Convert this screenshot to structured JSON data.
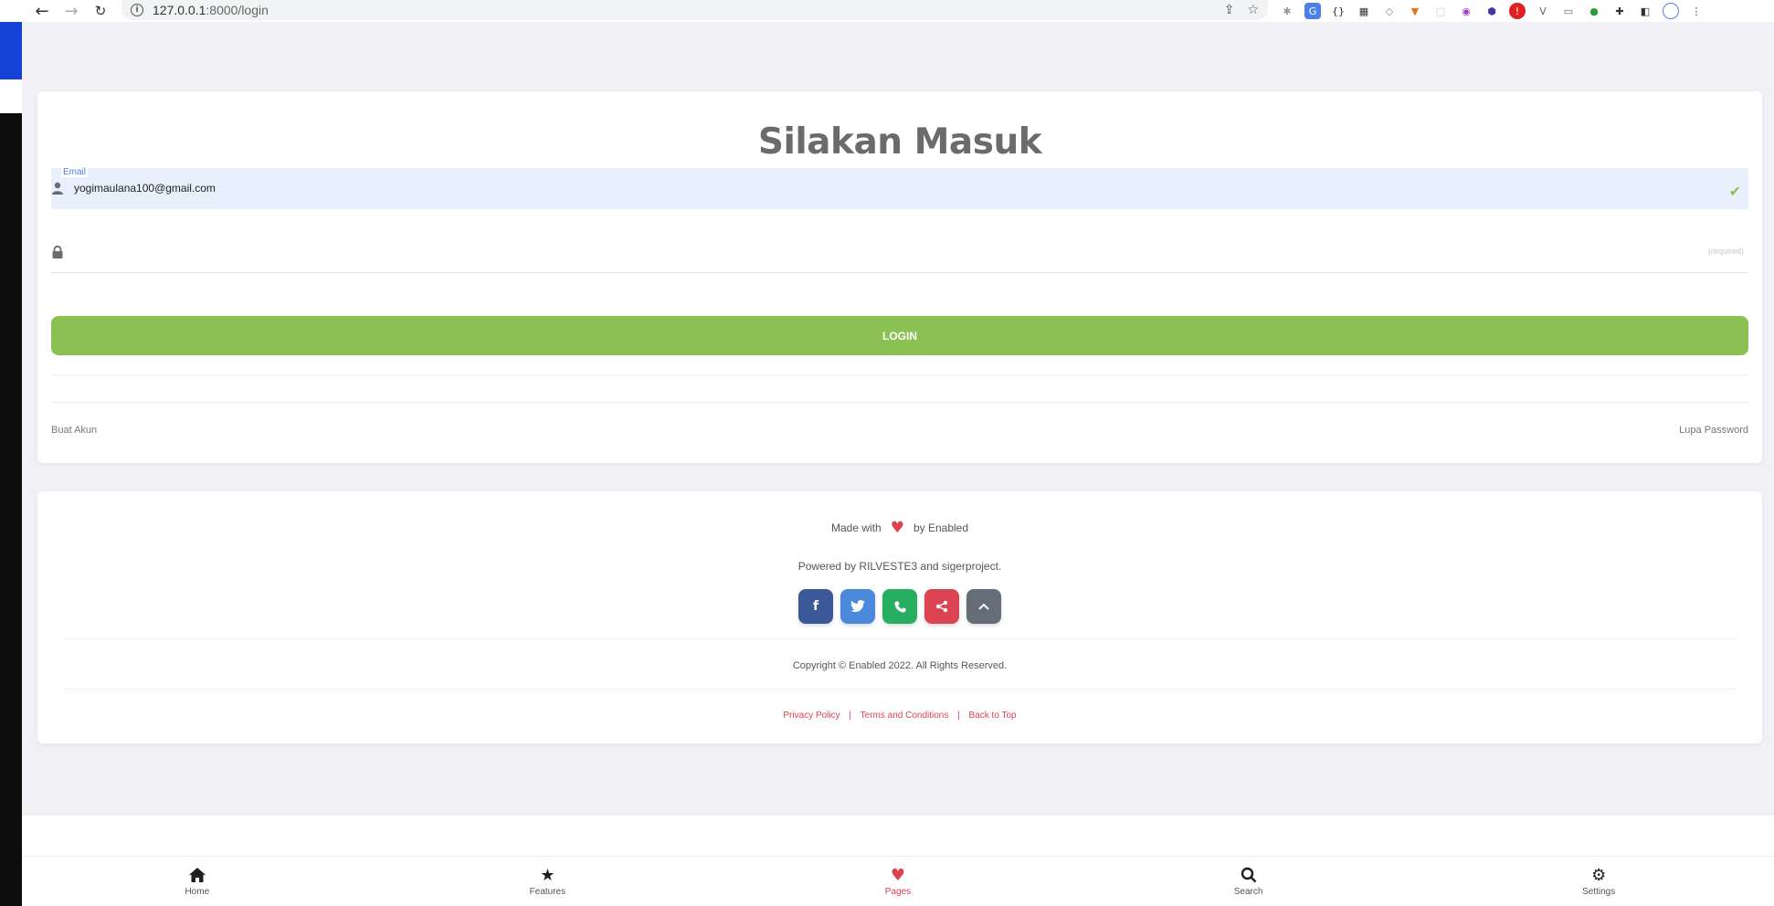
{
  "browser": {
    "url_host": "127.0.0.1",
    "url_path": ":8000/login",
    "info_icon": "i"
  },
  "login": {
    "title": "Silakan Masuk",
    "email_label": "Email",
    "email_value": "yogimaulana100@gmail.com",
    "password_required": "(required)",
    "login_button": "LOGIN",
    "create_account": "Buat Akun",
    "forgot_password": "Lupa Password"
  },
  "footer": {
    "made_with": "Made with",
    "by": "by Enabled",
    "powered": "Powered by RILVESTE3 and sigerproject.",
    "copyright": "Copyright © Enabled 2022. All Rights Reserved.",
    "privacy": "Privacy Policy",
    "terms": "Terms and Conditions",
    "back_to_top": "Back to Top",
    "separator": "|",
    "socials": [
      {
        "icon": "facebook-icon",
        "glyph": "f",
        "color": "#3b5998"
      },
      {
        "icon": "twitter-icon",
        "glyph": "t",
        "color": "#4a89dc"
      },
      {
        "icon": "phone-icon",
        "glyph": "☎",
        "color": "#27ae60"
      },
      {
        "icon": "share-icon",
        "glyph": "<",
        "color": "#da4453"
      },
      {
        "icon": "chevron-up-icon",
        "glyph": "^",
        "color": "#656d78"
      }
    ]
  },
  "bottom_nav": {
    "items": [
      {
        "label": "Home",
        "icon": "home-icon"
      },
      {
        "label": "Features",
        "icon": "star-icon"
      },
      {
        "label": "Pages",
        "icon": "heart-icon"
      },
      {
        "label": "Search",
        "icon": "search-icon"
      },
      {
        "label": "Settings",
        "icon": "gear-icon"
      }
    ]
  },
  "colors": {
    "accent_green": "#8bc152",
    "accent_red": "#da4453",
    "page_bg": "#f0f0f5"
  }
}
